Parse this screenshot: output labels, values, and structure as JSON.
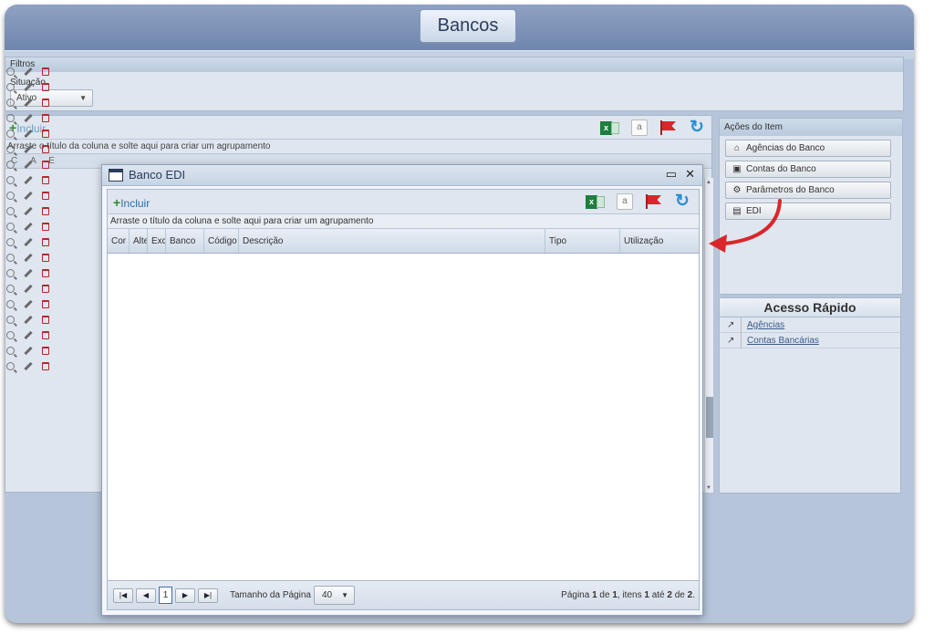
{
  "page": {
    "title": "Bancos"
  },
  "filtros": {
    "header": "Filtros",
    "situacao_label": "Situação",
    "situacao_value": "Ativo"
  },
  "grid": {
    "incluir": "Incluir",
    "group_hint": "Arraste o título da coluna e solte aqui para criar um agrupamento",
    "col_headers": [
      "C",
      "A",
      "E"
    ],
    "visible_rows": 20
  },
  "acoes": {
    "header": "Ações do Item",
    "buttons": [
      {
        "label": "Agências do Banco",
        "icon": "home-icon"
      },
      {
        "label": "Contas do Banco",
        "icon": "money-icon"
      },
      {
        "label": "Parâmetros do Banco",
        "icon": "gears-icon"
      },
      {
        "label": "EDI",
        "icon": "document-icon"
      }
    ]
  },
  "acesso": {
    "header": "Acesso Rápido",
    "links": [
      {
        "label": "Agências",
        "icon": "external-link-icon"
      },
      {
        "label": "Contas Bancárias",
        "icon": "external-link-icon"
      }
    ]
  },
  "modal": {
    "title": "Banco EDI",
    "incluir": "Incluir",
    "group_hint": "Arraste o título da coluna e solte aqui para criar um agrupamento",
    "columns": [
      "Cor",
      "Alte",
      "Exc",
      "Banco",
      "Código",
      "Descrição",
      "Tipo",
      "Utilização"
    ],
    "pager": {
      "first": "first-page-icon",
      "prev": "prev-page-icon",
      "page": "1",
      "next": "next-page-icon",
      "last": "last-page-icon",
      "page_size_label": "Tamanho da Página",
      "page_size": "40",
      "info_prefix": "Página ",
      "info_page": "1",
      "info_of": " de ",
      "info_total_pages": "1",
      "info_items": ", itens ",
      "info_from": "1",
      "info_to_word": " até ",
      "info_to": "2",
      "info_of2": " de ",
      "info_total": "2",
      "info_end": "."
    }
  },
  "colors": {
    "accent": "#2f6fa7",
    "annotation_arrow": "#d9262b",
    "header_bg": "#7f94b8"
  }
}
